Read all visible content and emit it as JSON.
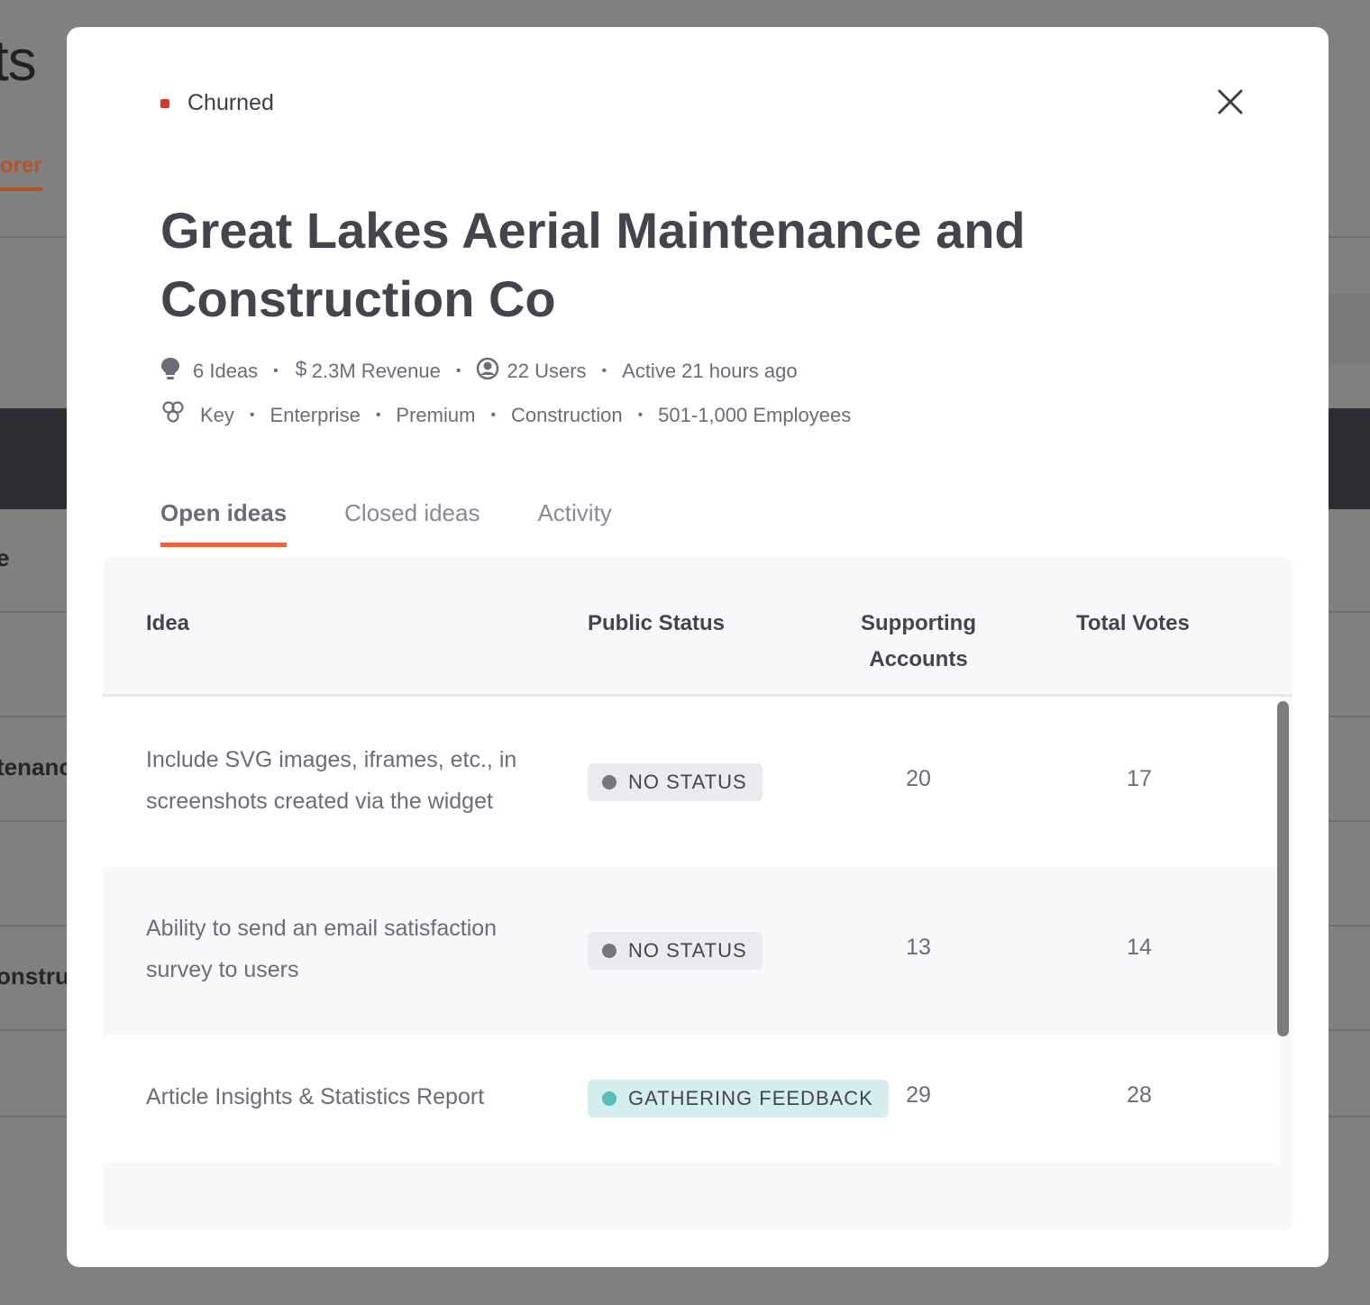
{
  "background": {
    "title_fragment": "ts",
    "tab_fragment": "orer",
    "row_fragments": [
      "e",
      "tenanc",
      "onstru"
    ]
  },
  "modal": {
    "status": {
      "label": "Churned",
      "color": "#d3372b"
    },
    "close_icon": "close-icon",
    "company_name": "Great Lakes Aerial Maintenance and Construction Co",
    "stats": [
      {
        "icon": "lightbulb-icon",
        "text": "6 Ideas"
      },
      {
        "icon": "dollar-icon",
        "text": "2.3M Revenue"
      },
      {
        "icon": "user-icon",
        "text": "22 Users"
      },
      {
        "icon": null,
        "text": "Active 21 hours ago"
      }
    ],
    "segments": {
      "icon": "segments-icon",
      "items": [
        "Key",
        "Enterprise",
        "Premium",
        "Construction",
        "501-1,000 Employees"
      ]
    },
    "tabs": [
      {
        "label": "Open ideas",
        "active": true
      },
      {
        "label": "Closed ideas",
        "active": false
      },
      {
        "label": "Activity",
        "active": false
      }
    ],
    "table": {
      "headers": {
        "idea": "Idea",
        "status": "Public Status",
        "supporting_1": "Supporting",
        "supporting_2": "Accounts",
        "votes": "Total Votes"
      },
      "rows": [
        {
          "idea": "Include SVG images, iframes, etc., in screenshots created via the widget",
          "status": "NO STATUS",
          "status_bg": "#ebebef",
          "status_dot": "#76767f",
          "supporting": "20",
          "votes": "17"
        },
        {
          "idea": "Ability to send an email satisfaction survey to users",
          "status": "NO STATUS",
          "status_bg": "#ebebef",
          "status_dot": "#76767f",
          "supporting": "13",
          "votes": "14"
        },
        {
          "idea": "Article Insights & Statistics Report",
          "status": "GATHERING FEEDBACK",
          "status_bg": "#d3eeec",
          "status_dot": "#57bebc",
          "supporting": "29",
          "votes": "28"
        }
      ]
    }
  },
  "colors": {
    "accent": "#e8643a",
    "text": "#44444f",
    "overlay": "#808080"
  }
}
